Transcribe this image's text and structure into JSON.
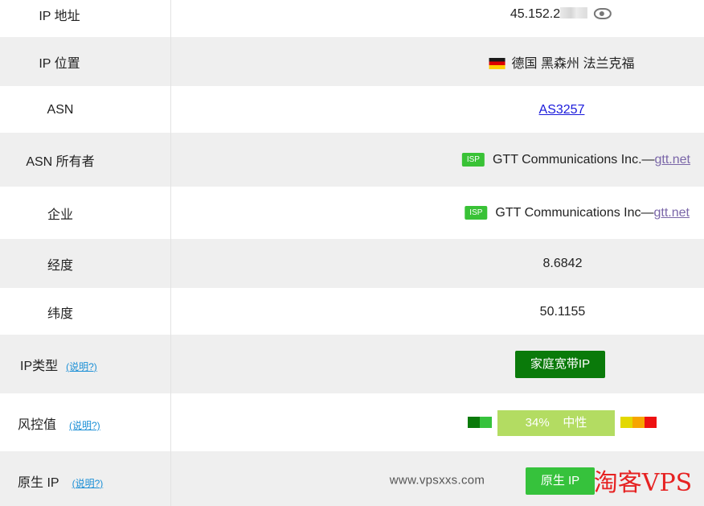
{
  "rows": {
    "ip_address": {
      "label": "IP 地址",
      "value": "45.152.2"
    },
    "ip_location": {
      "label": "IP 位置",
      "value": "德国 黑森州 法兰克福"
    },
    "asn": {
      "label": "ASN",
      "value": "AS3257"
    },
    "asn_owner": {
      "label": "ASN 所有者",
      "tag": "ISP",
      "org": "GTT Communications Inc.—",
      "domain": "gtt.net"
    },
    "enterprise": {
      "label": "企业",
      "tag": "ISP",
      "org": "GTT Communications Inc—",
      "domain": "gtt.net"
    },
    "longitude": {
      "label": "经度",
      "value": "8.6842"
    },
    "latitude": {
      "label": "纬度",
      "value": "50.1155"
    },
    "ip_type": {
      "label": "IP类型",
      "help": "(说明?)",
      "badge": "家庭宽带IP"
    },
    "risk": {
      "label": "风控值",
      "help": "(说明?)",
      "value": "34%",
      "level": "中性",
      "score": 34
    },
    "native_ip": {
      "label": "原生 IP",
      "help": "(说明?)",
      "badge": "原生 IP"
    }
  },
  "watermark": {
    "site": "www.vpsxxs.com",
    "brand": "淘客VPS"
  },
  "colors": {
    "row_alt": "#efefef",
    "link": "#1a1adb",
    "visited_link": "#7a66a8",
    "help_link": "#1a8fd6",
    "isp_tag": "#39c236",
    "badge_dark_green": "#0a7a0a",
    "badge_green": "#36c23c",
    "risk_neutral": "#b3dc62",
    "brand_red": "#e62222"
  },
  "icons": {
    "visibility": "eye-icon",
    "country_flag": "germany-flag-icon"
  }
}
